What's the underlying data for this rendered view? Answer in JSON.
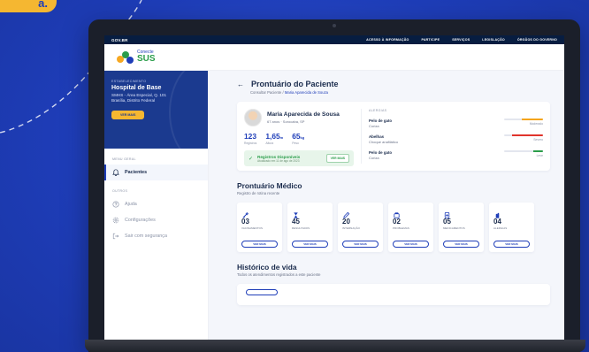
{
  "corner_tag": "a.",
  "govbar": {
    "logo": "GOV.BR",
    "links": [
      "ACESSO À INFORMAÇÃO",
      "PARTICIPE",
      "SERVIÇOS",
      "LEGISLAÇÃO",
      "ÓRGÃOS DO GOVERNO"
    ]
  },
  "brand": {
    "line1": "Conecte",
    "line2": "SUS"
  },
  "sidebar": {
    "estab_caption": "ESTABELECIMENTO",
    "estab_name": "Hospital de Base",
    "estab_addr1": "SMHS - Área Especial, Q. 101",
    "estab_addr2": "Brasília, Distrito Federal",
    "estab_button": "VER MAIS",
    "menu_geral": "MENU GERAL",
    "outros": "OUTROS",
    "items": [
      {
        "label": "Pacientes"
      },
      {
        "label": "Ajuda"
      },
      {
        "label": "Configurações"
      },
      {
        "label": "Sair com segurança"
      }
    ]
  },
  "page": {
    "title": "Prontuário do Paciente",
    "crumb_root": "Consultar Paciente",
    "crumb_sep": " / ",
    "crumb_current": "Maria Aparecida de Souza"
  },
  "patient": {
    "name": "Maria Aparecida de Sousa",
    "sub": "67 anos · Sorocaba, SP",
    "stats": [
      {
        "value": "123",
        "unit": "",
        "label": "Registros"
      },
      {
        "value": "1,65",
        "unit": "m",
        "label": "Altura"
      },
      {
        "value": "65",
        "unit": "kg",
        "label": "Peso"
      }
    ],
    "registros_title": "Registros Disponíveis",
    "registros_sub": "Atualizado em 11 de ago de 2023",
    "registros_btn": "VER MAIS"
  },
  "alergias": {
    "caption": "ALERGIAS",
    "items": [
      {
        "name": "Pelo de gato",
        "type": "Coriza",
        "level": "Moderado",
        "severity": 0.55,
        "color": "#f4a51c"
      },
      {
        "name": "Abelhas",
        "type": "Choque anafilático",
        "level": "Severo",
        "severity": 0.8,
        "color": "#e0342c"
      },
      {
        "name": "Pelo de gato",
        "type": "Coriza",
        "level": "Leve",
        "severity": 0.25,
        "color": "#2a9d4a"
      }
    ]
  },
  "medical": {
    "title": "Prontuário Médico",
    "subtitle": "Registro de rotina recente",
    "button": "VER MAIS",
    "cards": [
      {
        "icon": "vaccine-icon",
        "count": "03",
        "label": "VACINAMENTOS"
      },
      {
        "icon": "hourglass-icon",
        "count": "45",
        "label": "RESULTADOS"
      },
      {
        "icon": "pencil-icon",
        "count": "20",
        "label": "INTERNAÇÃO"
      },
      {
        "icon": "pill-icon",
        "count": "02",
        "label": "PROBLEMAS"
      },
      {
        "icon": "medication-icon",
        "count": "05",
        "label": "MEDICAMENTOS"
      },
      {
        "icon": "allergy-icon",
        "count": "04",
        "label": "ALERGIAS"
      }
    ]
  },
  "history": {
    "title": "Histórico de vida",
    "subtitle": "Todos os atendimentos registrados a este paciente"
  }
}
